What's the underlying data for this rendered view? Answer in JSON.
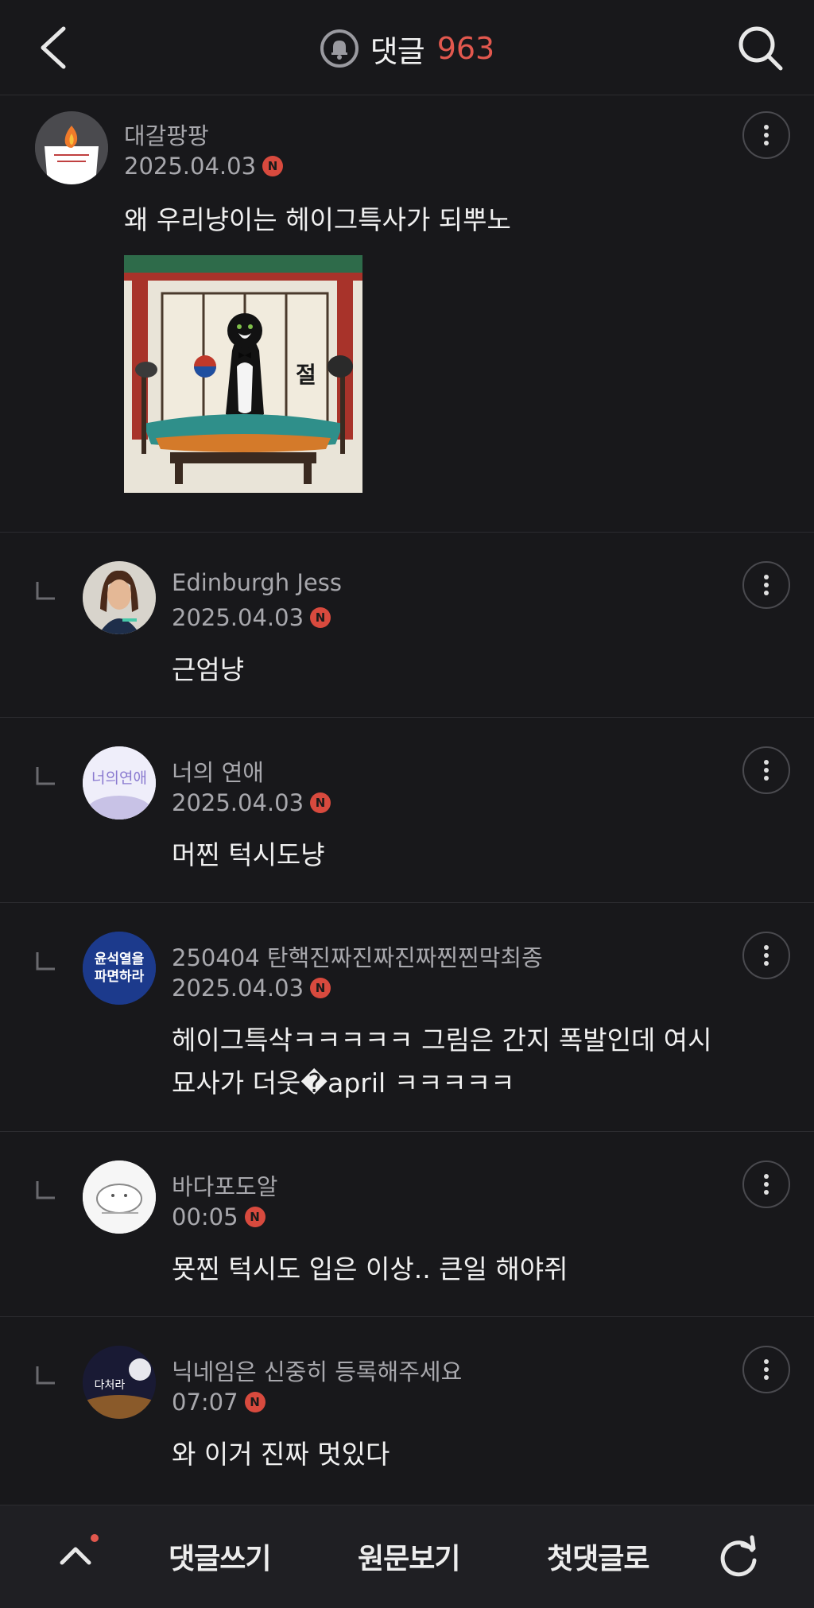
{
  "header": {
    "title": "댓글",
    "count": "963",
    "back_icon": "chevron-left-icon",
    "bell_icon": "bell-icon",
    "search_icon": "search-icon"
  },
  "comments": [
    {
      "nickname": "대갈팡팡",
      "date": "2025.04.03",
      "badge": "N",
      "text": "왜 우리냥이는 헤이그특사가 되뿌노",
      "has_image": true,
      "image_text": "절"
    },
    {
      "nickname": "Edinburgh Jess",
      "date": "2025.04.03",
      "badge": "N",
      "text": "근엄냥"
    },
    {
      "nickname": "너의 연애",
      "date": "2025.04.03",
      "badge": "N",
      "text": "머찐 턱시도냥",
      "avatar_text": "너의연애"
    },
    {
      "nickname": "250404 탄핵진짜진짜진짜찐찐막최종",
      "date": "2025.04.03",
      "badge": "N",
      "text_line1": "헤이그특삭ㅋㅋㅋㅋㅋ 그림은 간지 폭발인데 여시",
      "text_line2": "묘사가 더웃�april ㅋㅋㅋㅋㅋ",
      "avatar_line1": "윤석열을",
      "avatar_line2": "파면하라"
    },
    {
      "nickname": "바다포도알",
      "date": "00:05",
      "badge": "N",
      "text": "묫찐 턱시도 입은 이상.. 큰일 해야쥐"
    },
    {
      "nickname": "닉네임은 신중히 등록해주세요",
      "date": "07:07",
      "badge": "N",
      "text": "와 이거 진짜 멋있다",
      "avatar_text": "다처라"
    }
  ],
  "bottom_bar": {
    "up_icon": "chevron-up-icon",
    "write_label": "댓글쓰기",
    "original_label": "원문보기",
    "first_label": "첫댓글로",
    "refresh_icon": "refresh-icon"
  },
  "colors": {
    "background": "#18181b",
    "accent": "#e2584e",
    "divider": "#2c2c30"
  }
}
